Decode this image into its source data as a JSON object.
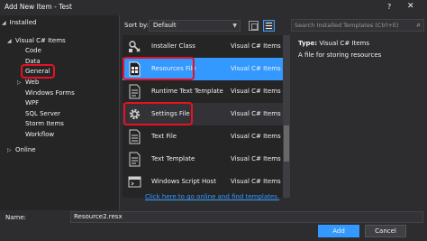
{
  "window": {
    "title": "Add New Item - Test",
    "help_glyph": "?",
    "close_glyph": "✕"
  },
  "tree": {
    "installed": "Installed",
    "visual_csharp": "Visual C# Items",
    "children": [
      "Code",
      "Data",
      "General"
    ],
    "web": "Web",
    "others": [
      "Windows Forms",
      "WPF",
      "SQL Server",
      "Storm Items",
      "Workflow"
    ],
    "online": "Online"
  },
  "toolbar": {
    "sort_label": "Sort by:",
    "sort_value": "Default"
  },
  "search": {
    "placeholder": "Search Installed Templates (Ctrl+E)"
  },
  "templates": [
    {
      "name": "Installer Class",
      "lang": "Visual C# Items",
      "icon": "installer-icon",
      "selected": false
    },
    {
      "name": "Resources File",
      "lang": "Visual C# Items",
      "icon": "resources-file-icon",
      "selected": true
    },
    {
      "name": "Runtime Text Template",
      "lang": "Visual C# Items",
      "icon": "text-template-icon",
      "selected": false
    },
    {
      "name": "Settings File",
      "lang": "Visual C# Items",
      "icon": "gear-icon",
      "selected": false
    },
    {
      "name": "Text File",
      "lang": "Visual C# Items",
      "icon": "text-file-icon",
      "selected": false
    },
    {
      "name": "Text Template",
      "lang": "Visual C# Items",
      "icon": "text-template-icon",
      "selected": false
    },
    {
      "name": "Windows Script Host",
      "lang": "Visual C# Items",
      "icon": "script-icon",
      "selected": false
    }
  ],
  "online_link": "Click here to go online and find templates.",
  "details": {
    "type_label": "Type:",
    "type_value": "Visual C# Items",
    "description": "A file for storing resources"
  },
  "footer": {
    "name_label": "Name:",
    "name_value": "Resource2.resx",
    "add_label": "Add",
    "cancel_label": "Cancel"
  },
  "colors": {
    "accent": "#3399ff",
    "callout": "#e81123",
    "background": "#2d2d30",
    "panel": "#252526"
  }
}
